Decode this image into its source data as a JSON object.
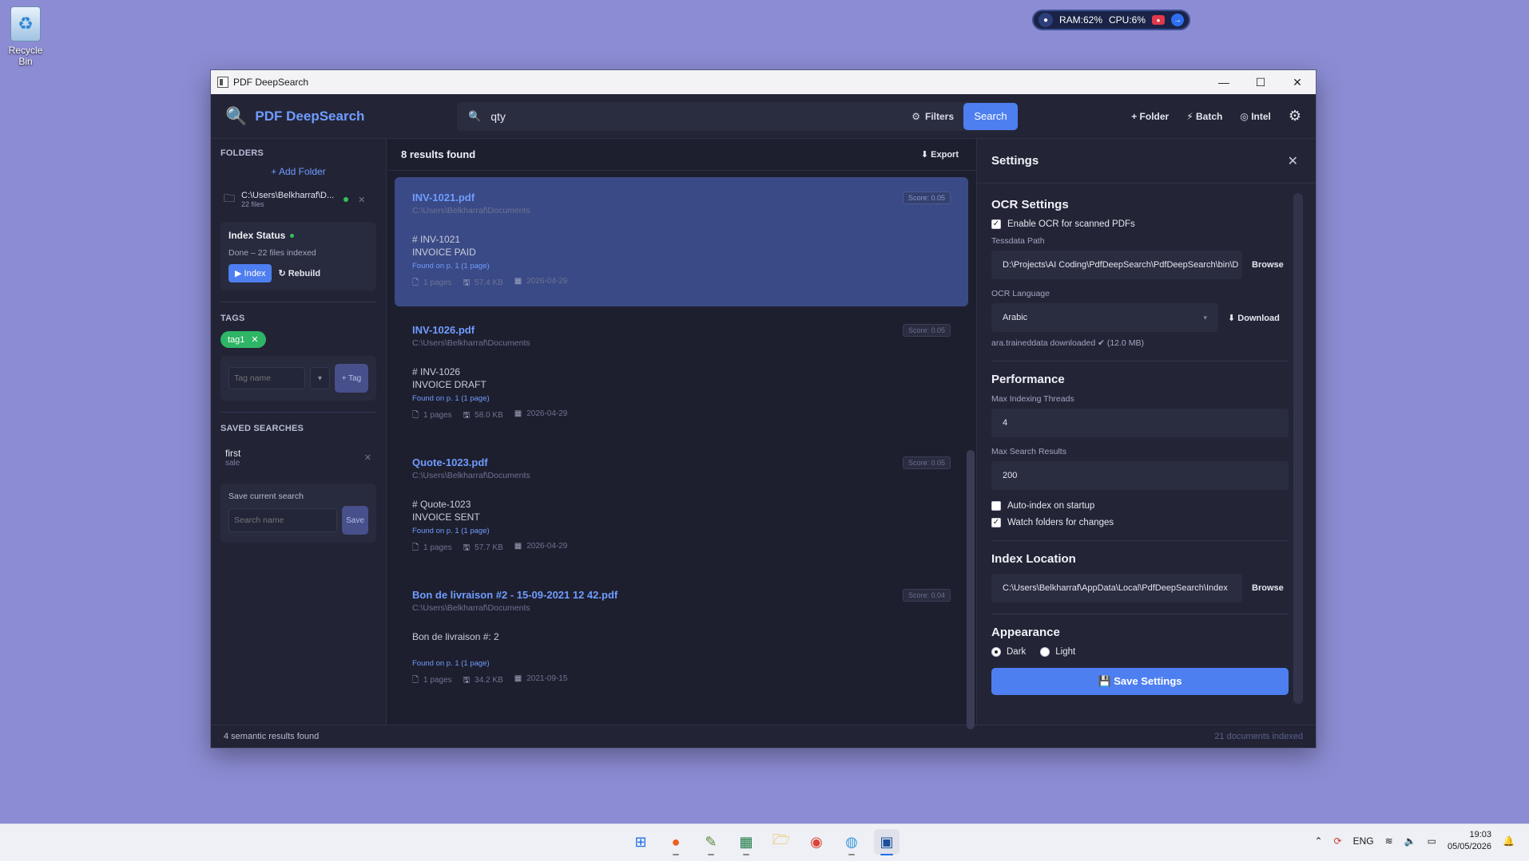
{
  "desktop": {
    "recycle_bin": "Recycle Bin"
  },
  "widget": {
    "ram": "RAM:62%",
    "cpu": "CPU:6%"
  },
  "window": {
    "title": "PDF DeepSearch"
  },
  "header": {
    "app_name": "PDF DeepSearch",
    "search_value": "qty",
    "filters_label": "Filters",
    "search_button": "Search",
    "folder_label": "+ Folder",
    "batch_label": "Batch",
    "intel_label": "Intel"
  },
  "sidebar": {
    "folders_title": "FOLDERS",
    "add_folder": "+ Add Folder",
    "folder_path": "C:\\Users\\Belkharraf\\D...",
    "folder_count": "22 files",
    "index_title": "Index Status",
    "index_status": "Done – 22 files indexed",
    "index_button": "Index",
    "rebuild_button": "Rebuild",
    "tags_title": "TAGS",
    "tag": "tag1",
    "tag_placeholder": "Tag name",
    "tag_button": "+ Tag",
    "saved_title": "SAVED SEARCHES",
    "saved_name": "first",
    "saved_query": "sale",
    "save_current": "Save current search",
    "search_name_placeholder": "Search name",
    "save_button": "Save"
  },
  "results": {
    "count": "8 results found",
    "export": "Export",
    "items": [
      {
        "name": "INV-1021.pdf",
        "score": "Score: 0.05",
        "path": "C:\\Users\\Belkharraf\\Documents",
        "line1": "# INV-1021",
        "line2": "INVOICE PAID",
        "found": "Found on p. 1 (1 page)",
        "pages": "1 pages",
        "size": "57.4 KB",
        "date": "2026-04-29"
      },
      {
        "name": "INV-1026.pdf",
        "score": "Score: 0.05",
        "path": "C:\\Users\\Belkharraf\\Documents",
        "line1": "# INV-1026",
        "line2": "INVOICE DRAFT",
        "found": "Found on p. 1 (1 page)",
        "pages": "1 pages",
        "size": "58.0 KB",
        "date": "2026-04-29"
      },
      {
        "name": "Quote-1023.pdf",
        "score": "Score: 0.05",
        "path": "C:\\Users\\Belkharraf\\Documents",
        "line1": "# Quote-1023",
        "line2": "INVOICE SENT",
        "found": "Found on p. 1 (1 page)",
        "pages": "1 pages",
        "size": "57.7 KB",
        "date": "2026-04-29"
      },
      {
        "name": "Bon de livraison #2 - 15-09-2021 12 42.pdf",
        "score": "Score: 0.04",
        "path": "C:\\Users\\Belkharraf\\Documents",
        "line1": "Bon de livraison #: 2",
        "line2": "",
        "found": "Found on p. 1 (1 page)",
        "pages": "1 pages",
        "size": "34.2 KB",
        "date": "2021-09-15"
      }
    ]
  },
  "settings": {
    "title": "Settings",
    "ocr_title": "OCR Settings",
    "enable_ocr": "Enable OCR for scanned PDFs",
    "tessdata_label": "Tessdata Path",
    "tessdata_path": "D:\\Projects\\AI Coding\\PdfDeepSearch\\PdfDeepSearch\\bin\\D",
    "browse": "Browse",
    "ocr_lang_label": "OCR Language",
    "ocr_lang": "Arabic",
    "download": "Download",
    "downloaded_note": "ara.traineddata downloaded",
    "downloaded_size": "(12.0 MB)",
    "perf_title": "Performance",
    "threads_label": "Max Indexing Threads",
    "threads_value": "4",
    "max_results_label": "Max Search Results",
    "max_results_value": "200",
    "auto_index": "Auto-index on startup",
    "watch_folders": "Watch folders for changes",
    "index_loc_title": "Index Location",
    "index_path": "C:\\Users\\Belkharraf\\AppData\\Local\\PdfDeepSearch\\Index",
    "appearance_title": "Appearance",
    "dark": "Dark",
    "light": "Light",
    "save_settings": "Save Settings"
  },
  "status": {
    "left": "4 semantic results found",
    "right": "21 documents indexed"
  },
  "taskbar": {
    "lang": "ENG",
    "time": "19:03",
    "date": "05/05/2026"
  }
}
